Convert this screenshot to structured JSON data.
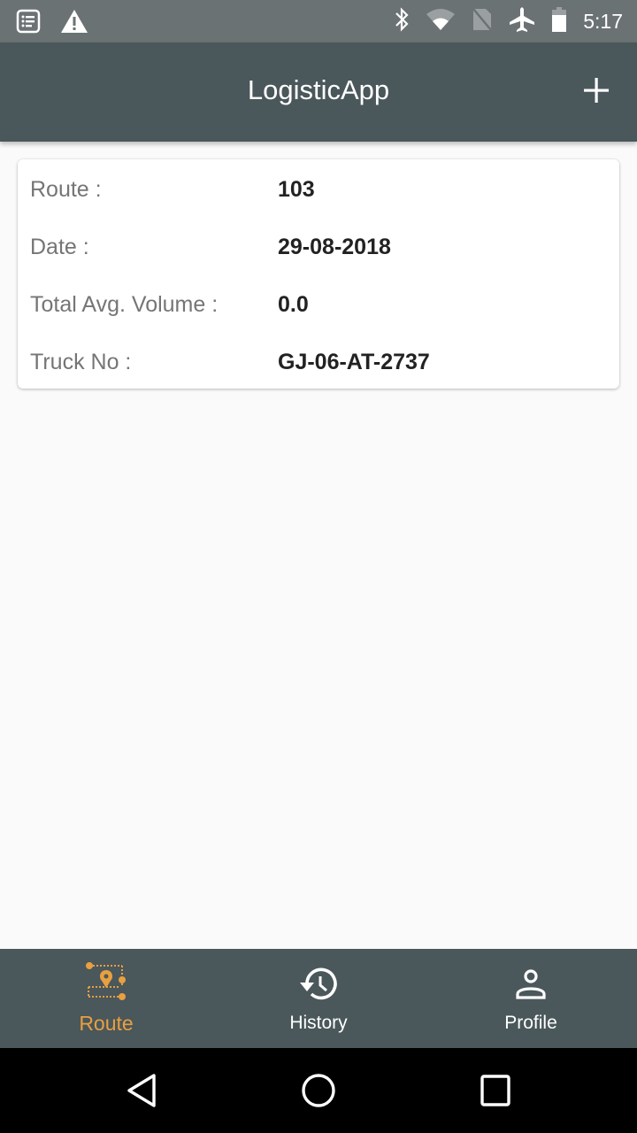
{
  "status_bar": {
    "time": "5:17",
    "left_icons": [
      "notification-list-icon",
      "warning-icon"
    ],
    "right_icons": [
      "bluetooth-icon",
      "wifi-icon",
      "no-sim-icon",
      "airplane-mode-icon",
      "battery-icon"
    ]
  },
  "app_bar": {
    "title": "LogisticApp",
    "action_icon": "add-icon"
  },
  "route_card": {
    "rows": [
      {
        "label": "Route :",
        "value": "103"
      },
      {
        "label": "Date :",
        "value": "29-08-2018"
      },
      {
        "label": "Total Avg. Volume :",
        "value": "0.0"
      },
      {
        "label": "Truck No :",
        "value": "GJ-06-AT-2737"
      }
    ]
  },
  "bottom_nav": {
    "active_color": "#e8a040",
    "items": [
      {
        "label": "Route",
        "icon": "route-map-icon",
        "active": true
      },
      {
        "label": "History",
        "icon": "history-icon",
        "active": false
      },
      {
        "label": "Profile",
        "icon": "profile-icon",
        "active": false
      }
    ]
  },
  "system_nav": {
    "buttons": [
      "back",
      "home",
      "recents"
    ]
  }
}
